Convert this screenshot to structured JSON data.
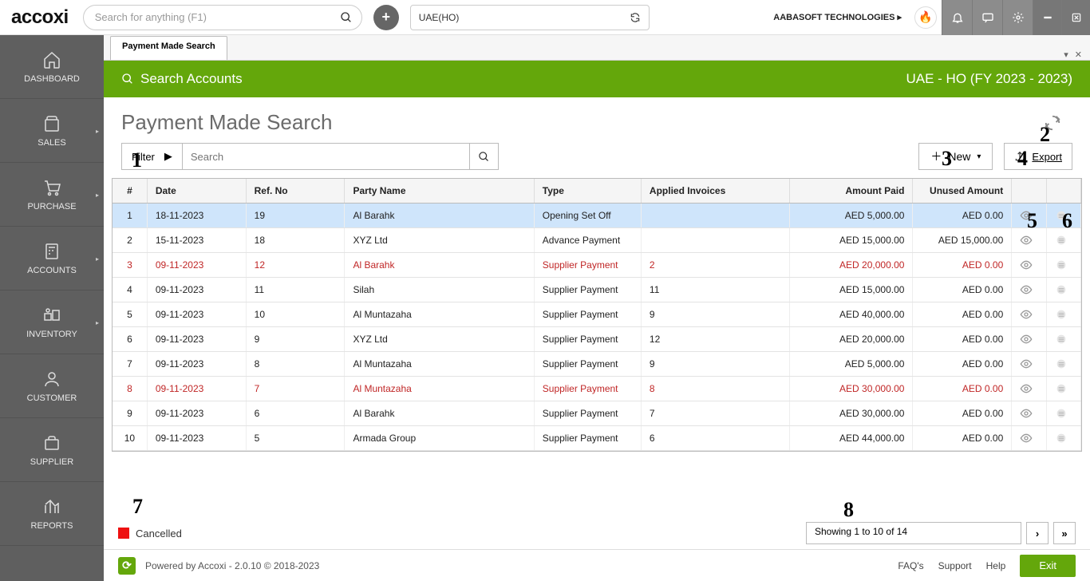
{
  "header": {
    "logo": "accoxi",
    "search_placeholder": "Search for anything (F1)",
    "branch": "UAE(HO)",
    "company": "AABASOFT TECHNOLOGIES"
  },
  "sidebar": {
    "items": [
      {
        "label": "DASHBOARD"
      },
      {
        "label": "SALES"
      },
      {
        "label": "PURCHASE"
      },
      {
        "label": "ACCOUNTS"
      },
      {
        "label": "INVENTORY"
      },
      {
        "label": "CUSTOMER"
      },
      {
        "label": "SUPPLIER"
      },
      {
        "label": "REPORTS"
      }
    ]
  },
  "tab": {
    "label": "Payment Made Search"
  },
  "greenbar": {
    "left": "Search Accounts",
    "right": "UAE - HO (FY 2023 - 2023)"
  },
  "page": {
    "title": "Payment Made Search"
  },
  "filter": {
    "label": "Filter",
    "search_placeholder": "Search",
    "new_label": "New",
    "export_label": "Export"
  },
  "table": {
    "columns": [
      "#",
      "Date",
      "Ref. No",
      "Party Name",
      "Type",
      "Applied Invoices",
      "Amount Paid",
      "Unused Amount"
    ],
    "rows": [
      {
        "n": "1",
        "date": "18-11-2023",
        "ref": "19",
        "party": "Al Barahk",
        "type": "Opening Set Off",
        "inv": "",
        "amt": "AED 5,000.00",
        "un": "AED 0.00",
        "cancelled": false,
        "selected": true
      },
      {
        "n": "2",
        "date": "15-11-2023",
        "ref": "18",
        "party": "XYZ Ltd",
        "type": "Advance Payment",
        "inv": "",
        "amt": "AED 15,000.00",
        "un": "AED 15,000.00",
        "cancelled": false
      },
      {
        "n": "3",
        "date": "09-11-2023",
        "ref": "12",
        "party": "Al Barahk",
        "type": "Supplier Payment",
        "inv": "2",
        "amt": "AED 20,000.00",
        "un": "AED 0.00",
        "cancelled": true
      },
      {
        "n": "4",
        "date": "09-11-2023",
        "ref": "11",
        "party": "Silah",
        "type": "Supplier Payment",
        "inv": "11",
        "amt": "AED 15,000.00",
        "un": "AED 0.00",
        "cancelled": false
      },
      {
        "n": "5",
        "date": "09-11-2023",
        "ref": "10",
        "party": "Al Muntazaha",
        "type": "Supplier Payment",
        "inv": "9",
        "amt": "AED 40,000.00",
        "un": "AED 0.00",
        "cancelled": false
      },
      {
        "n": "6",
        "date": "09-11-2023",
        "ref": "9",
        "party": "XYZ Ltd",
        "type": "Supplier Payment",
        "inv": "12",
        "amt": "AED 20,000.00",
        "un": "AED 0.00",
        "cancelled": false
      },
      {
        "n": "7",
        "date": "09-11-2023",
        "ref": "8",
        "party": "Al Muntazaha",
        "type": "Supplier Payment",
        "inv": "9",
        "amt": "AED 5,000.00",
        "un": "AED 0.00",
        "cancelled": false
      },
      {
        "n": "8",
        "date": "09-11-2023",
        "ref": "7",
        "party": "Al Muntazaha",
        "type": "Supplier Payment",
        "inv": "8",
        "amt": "AED 30,000.00",
        "un": "AED 0.00",
        "cancelled": true
      },
      {
        "n": "9",
        "date": "09-11-2023",
        "ref": "6",
        "party": "Al Barahk",
        "type": "Supplier Payment",
        "inv": "7",
        "amt": "AED 30,000.00",
        "un": "AED 0.00",
        "cancelled": false
      },
      {
        "n": "10",
        "date": "09-11-2023",
        "ref": "5",
        "party": "Armada Group",
        "type": "Supplier Payment",
        "inv": "6",
        "amt": "AED 44,000.00",
        "un": "AED 0.00",
        "cancelled": false
      }
    ]
  },
  "legend": {
    "label": "Cancelled"
  },
  "pagination": {
    "text": "Showing 1 to 10 of 14"
  },
  "footer": {
    "powered": "Powered by Accoxi - 2.0.10 © 2018-2023",
    "links": [
      "FAQ's",
      "Support",
      "Help"
    ],
    "exit": "Exit"
  },
  "annotations": [
    "1",
    "2",
    "3",
    "4",
    "5",
    "6",
    "7",
    "8"
  ]
}
